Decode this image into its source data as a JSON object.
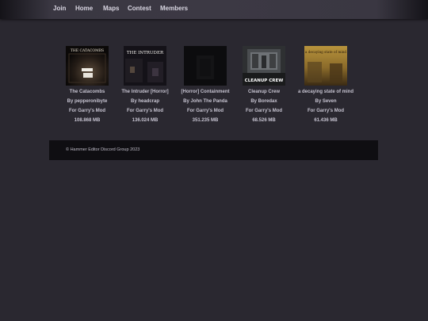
{
  "nav": {
    "items": [
      {
        "label": "Join"
      },
      {
        "label": "Home"
      },
      {
        "label": "Maps"
      },
      {
        "label": "Contest"
      },
      {
        "label": "Members"
      }
    ]
  },
  "maps": [
    {
      "title": "The Catacombs",
      "author": "By pepperonibyte",
      "game": "For Garry's Mod",
      "size": "108.868 MB",
      "thumb_text": "THE CATACOMBS"
    },
    {
      "title": "The Intruder [Horror]",
      "author": "By headcrap",
      "game": "For Garry's Mod",
      "size": "136.024 MB",
      "thumb_text": "THE INTRUDER"
    },
    {
      "title": "[Horror] Containment",
      "author": "By John The Panda",
      "game": "For Garry's Mod",
      "size": "351.235 MB"
    },
    {
      "title": "Cleanup Crew",
      "author": "By Boredax",
      "game": "For Garry's Mod",
      "size": "68.526 MB",
      "thumb_text": "CLEANUP CREW"
    },
    {
      "title": "a decaying state of mind",
      "author": "By Seven",
      "game": "For Garry's Mod",
      "size": "61.436 MB",
      "thumb_text": "a decaying state of mind"
    }
  ],
  "footer": {
    "text": "© Hammer Editor Discord Group 2023"
  }
}
